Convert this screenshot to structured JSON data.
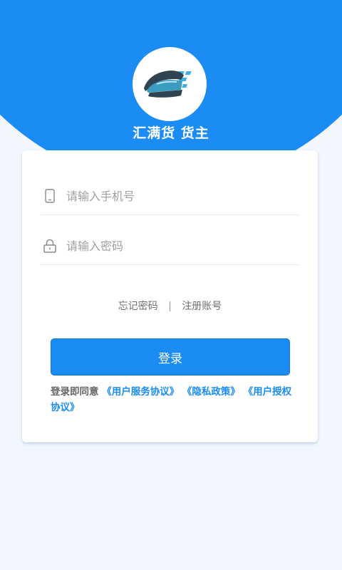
{
  "app": {
    "name": "汇满货 货主"
  },
  "form": {
    "phone_placeholder": "请输入手机号",
    "password_placeholder": "请输入密码"
  },
  "links": {
    "forgot_password": "忘记密码",
    "separator": "|",
    "register": "注册账号"
  },
  "login_button": "登录",
  "agreement": {
    "prefix": "登录即同意",
    "user_service": "《用户服务协议》",
    "privacy": "《隐私政策》",
    "user_auth": "《用户授权协议》"
  },
  "colors": {
    "primary": "#1a8cf3",
    "background": "#f2f7fd",
    "card": "#ffffff"
  },
  "icons": {
    "logo": "car-logo-icon",
    "phone": "phone-icon",
    "lock": "lock-icon"
  }
}
